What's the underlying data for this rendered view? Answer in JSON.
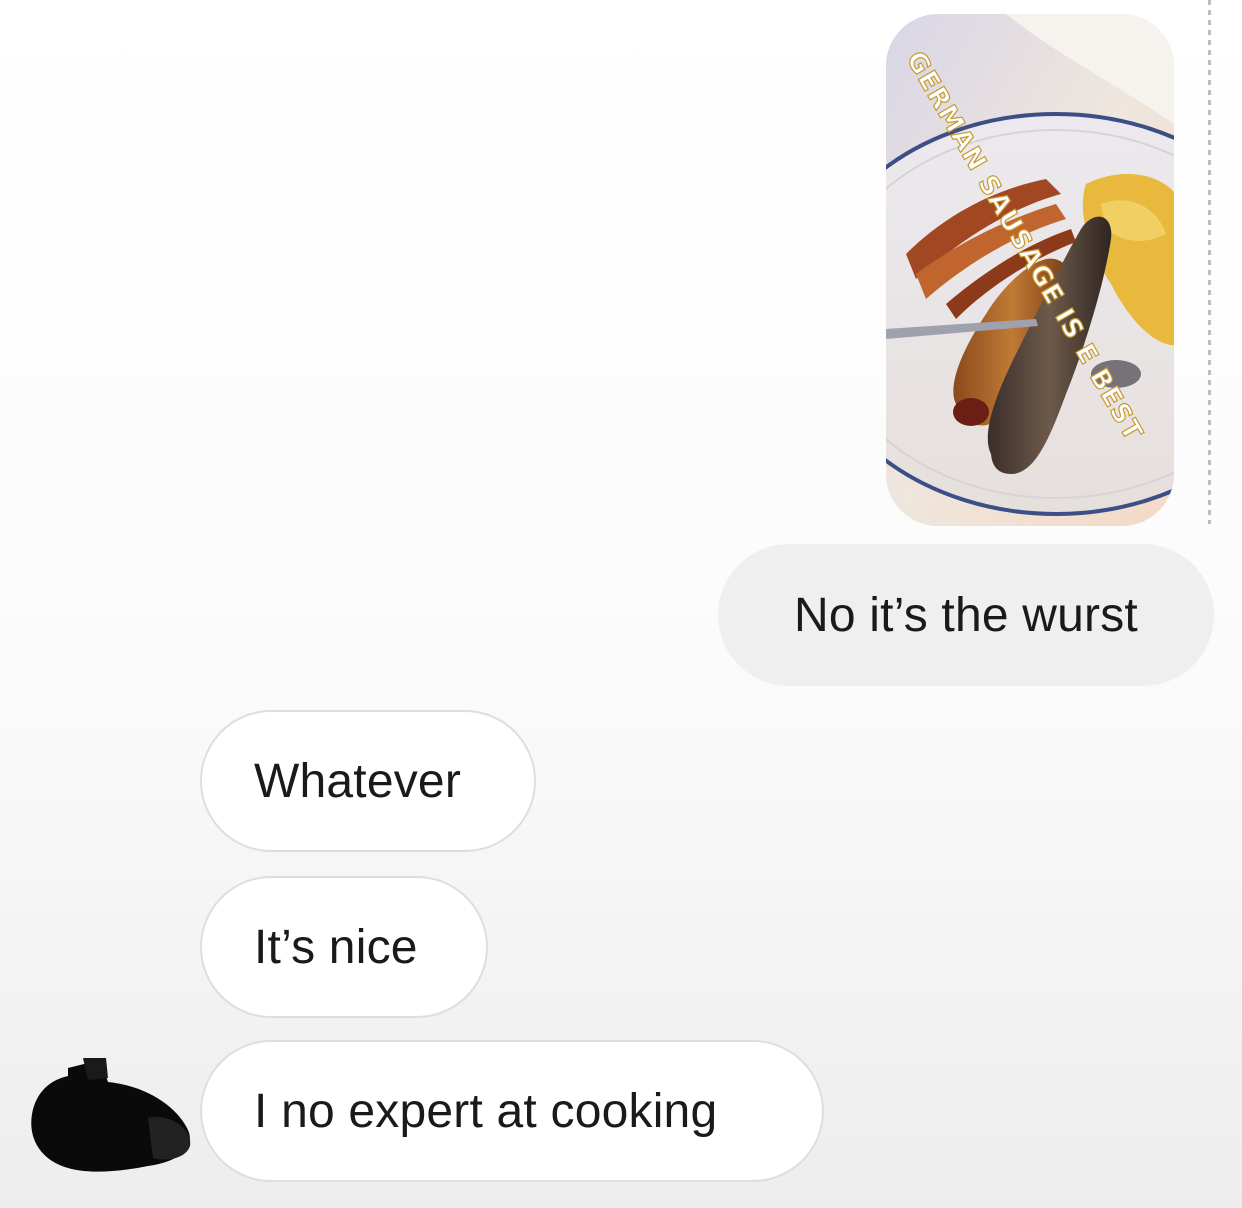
{
  "story": {
    "caption_overlay": "GERMAN SAUSAGE IS E BEST"
  },
  "messages": [
    {
      "sender": "me",
      "text": "No it’s the wurst"
    },
    {
      "sender": "them",
      "text": "Whatever"
    },
    {
      "sender": "them",
      "text": "It’s nice"
    },
    {
      "sender": "them",
      "text": "I no expert at cooking"
    }
  ],
  "colors": {
    "sent_bubble": "#efefef",
    "received_bubble": "#ffffff",
    "received_border": "#dedede",
    "text": "#1a1a1a"
  },
  "icons": {
    "avatar": "redacted-avatar"
  }
}
